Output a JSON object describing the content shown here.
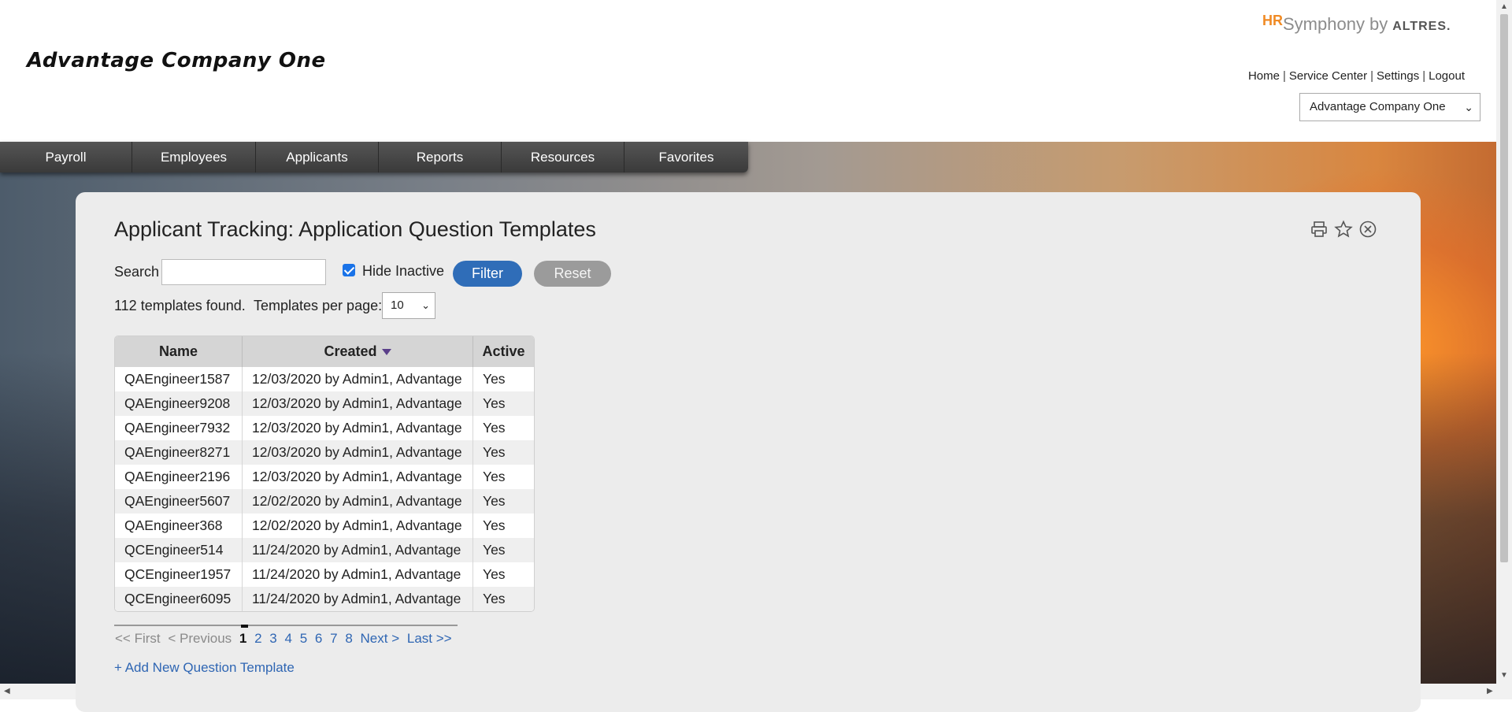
{
  "header": {
    "company_name": "Advantage Company One",
    "brand": {
      "hr": "HR",
      "symphony": "Symphony",
      "by": "by",
      "altres": "ALTRES."
    },
    "links": [
      "Home",
      "Service Center",
      "Settings",
      "Logout"
    ],
    "company_select_value": "Advantage Company One"
  },
  "nav": {
    "items": [
      {
        "label": "Payroll"
      },
      {
        "label": "Employees"
      },
      {
        "label": "Applicants"
      },
      {
        "label": "Reports"
      },
      {
        "label": "Resources"
      },
      {
        "label": "Favorites"
      }
    ]
  },
  "main": {
    "title": "Applicant Tracking: Application Question Templates",
    "search": {
      "label": "Search",
      "value": "",
      "placeholder": ""
    },
    "hide_inactive": {
      "label": "Hide Inactive",
      "checked": true
    },
    "filter_label": "Filter",
    "reset_label": "Reset",
    "found_text": "112 templates found.",
    "per_page_label": "Templates per page:",
    "per_page_value": "10",
    "table": {
      "headers": [
        "Name",
        "Created",
        "Active"
      ],
      "rows": [
        [
          "QAEngineer1587",
          "12/03/2020 by Admin1, Advantage",
          "Yes"
        ],
        [
          "QAEngineer9208",
          "12/03/2020 by Admin1, Advantage",
          "Yes"
        ],
        [
          "QAEngineer7932",
          "12/03/2020 by Admin1, Advantage",
          "Yes"
        ],
        [
          "QAEngineer8271",
          "12/03/2020 by Admin1, Advantage",
          "Yes"
        ],
        [
          "QAEngineer2196",
          "12/03/2020 by Admin1, Advantage",
          "Yes"
        ],
        [
          "QAEngineer5607",
          "12/02/2020 by Admin1, Advantage",
          "Yes"
        ],
        [
          "QAEngineer368",
          "12/02/2020 by Admin1, Advantage",
          "Yes"
        ],
        [
          "QCEngineer514",
          "11/24/2020 by Admin1, Advantage",
          "Yes"
        ],
        [
          "QCEngineer1957",
          "11/24/2020 by Admin1, Advantage",
          "Yes"
        ],
        [
          "QCEngineer6095",
          "11/24/2020 by Admin1, Advantage",
          "Yes"
        ]
      ]
    },
    "pager": {
      "first": "<< First",
      "previous": "< Previous",
      "pages": [
        "1",
        "2",
        "3",
        "4",
        "5",
        "6",
        "7",
        "8"
      ],
      "current": "1",
      "next": "Next >",
      "last": "Last >>"
    },
    "add_link": "+ Add New Question Template"
  },
  "icons": {
    "print": "print-icon",
    "favorite": "star-icon",
    "close": "close-circle-icon"
  },
  "colors": {
    "filter_button": "#2f6db8",
    "reset_button": "#9b9b9b",
    "link": "#2f66b3",
    "brand_orange": "#f08a24",
    "nav_bg": "#3a3a3a"
  }
}
